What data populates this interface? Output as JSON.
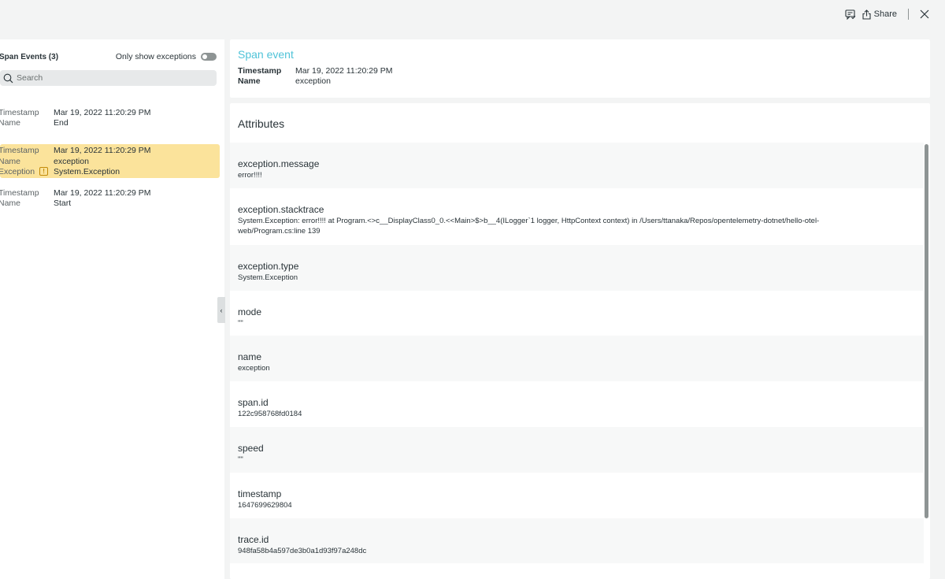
{
  "toolbar": {
    "share_label": "Share",
    "icons": [
      "feedback-icon",
      "share-icon",
      "close-icon"
    ]
  },
  "left": {
    "title": "Span Events (3)",
    "toggle_label": "Only show exceptions",
    "toggle_on": false,
    "search_placeholder": "Search",
    "labels": {
      "timestamp": "Timestamp",
      "name": "Name",
      "exception": "Exception"
    },
    "events": [
      {
        "timestamp": "Mar 19, 2022 11:20:29 PM",
        "name": "End"
      },
      {
        "timestamp": "Mar 19, 2022 11:20:29 PM",
        "name": "exception",
        "exception": "System.Exception"
      },
      {
        "timestamp": "Mar 19, 2022 11:20:29 PM",
        "name": "Start"
      }
    ],
    "collapse_glyph": "‹"
  },
  "span_event": {
    "title": "Span event",
    "timestamp_label": "Timestamp",
    "timestamp": "Mar 19, 2022 11:20:29 PM",
    "name_label": "Name",
    "name": "exception"
  },
  "attributes": {
    "heading": "Attributes",
    "items": [
      {
        "key": "exception.message",
        "value": "error!!!!"
      },
      {
        "key": "exception.stacktrace",
        "value": "System.Exception: error!!!! at Program.<>c__DisplayClass0_0.<<Main>$>b__4(ILogger`1 logger, HttpContext context) in /Users/ttanaka/Repos/opentelemetry-dotnet/hello-otel-web/Program.cs:line 139"
      },
      {
        "key": "exception.type",
        "value": "System.Exception"
      },
      {
        "key": "mode",
        "value": "\"\""
      },
      {
        "key": "name",
        "value": "exception"
      },
      {
        "key": "span.id",
        "value": "122c958768fd0184"
      },
      {
        "key": "speed",
        "value": "\"\""
      },
      {
        "key": "timestamp",
        "value": "1647699629804"
      },
      {
        "key": "trace.id",
        "value": "948fa58b4a597de3b0a1d93f97a248dc"
      }
    ]
  },
  "colors": {
    "accent": "#4fc3d8",
    "selected_row": "#fbe39b",
    "warning": "#c28a08"
  }
}
